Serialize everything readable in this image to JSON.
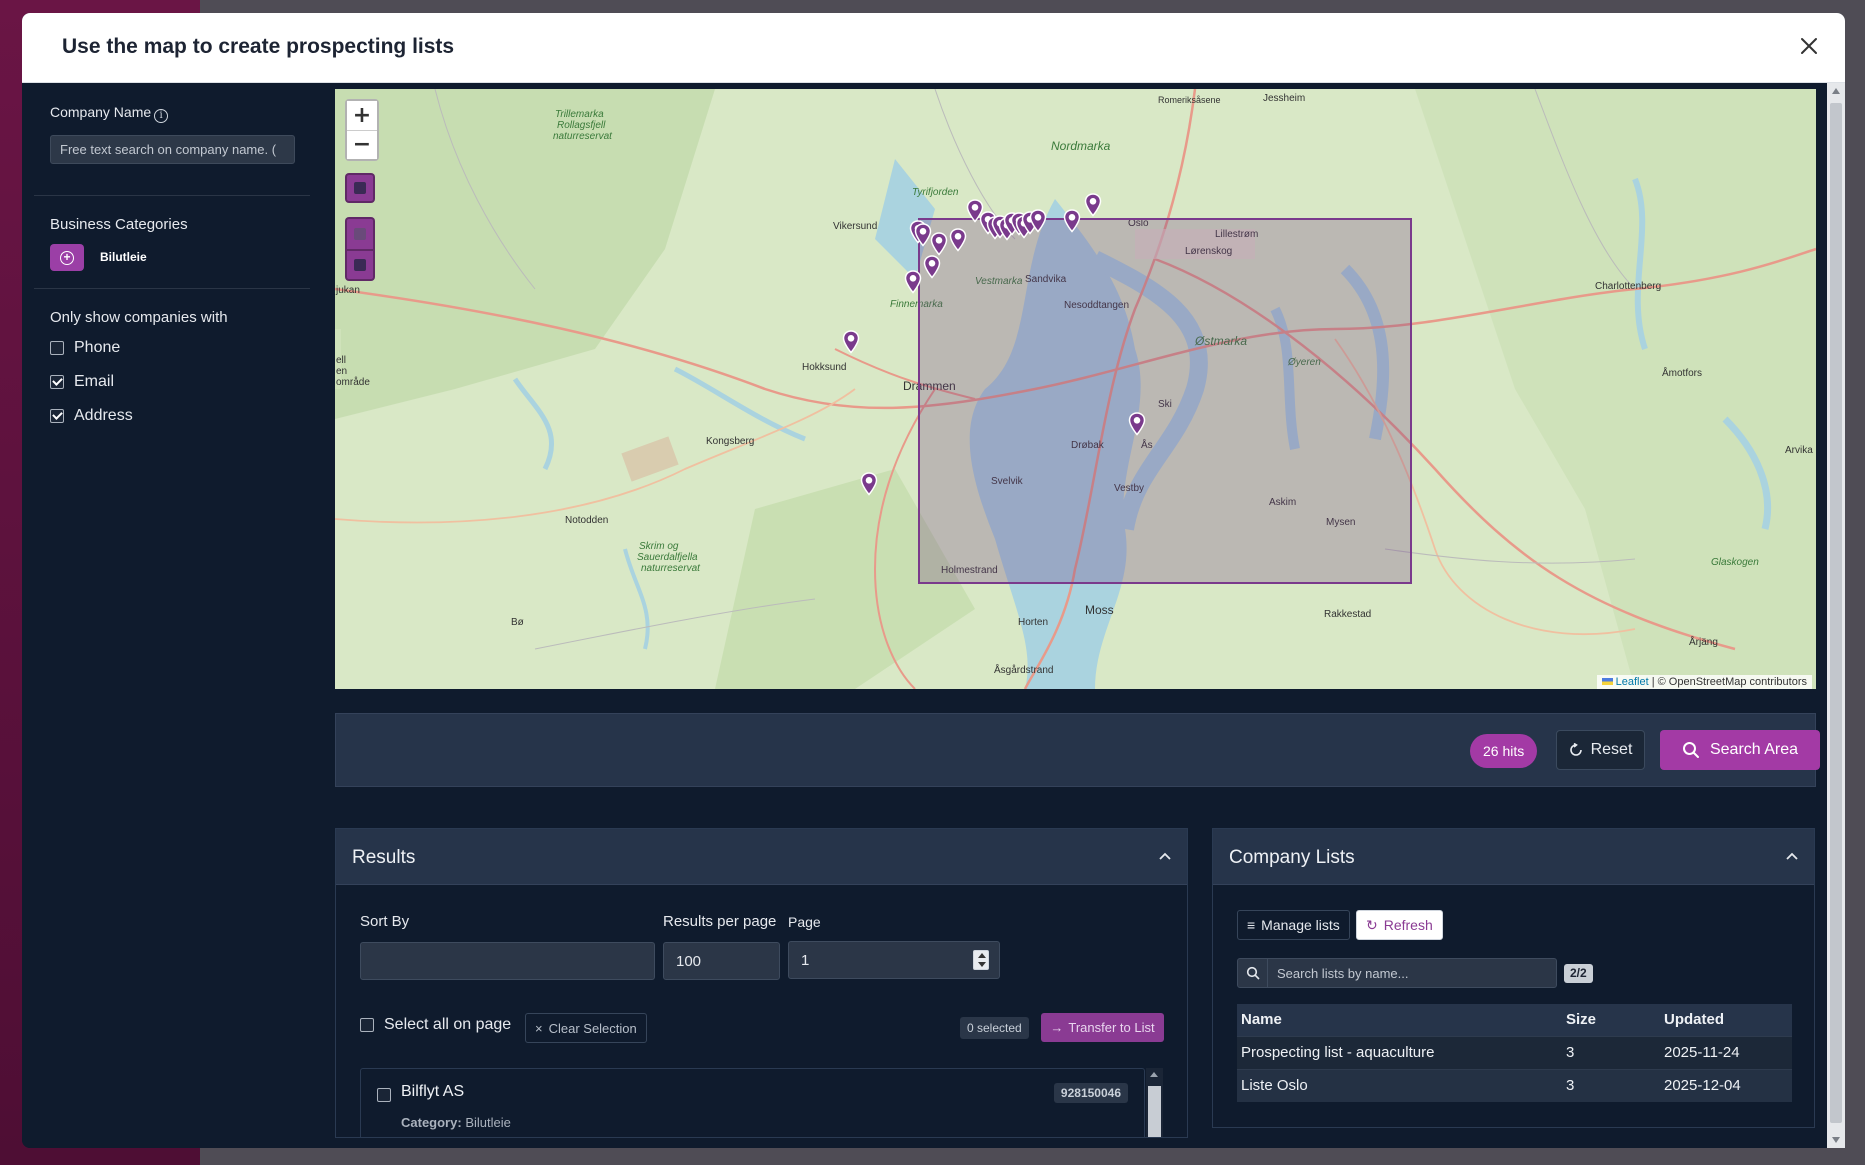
{
  "modal": {
    "title": "Use the map to create prospecting lists"
  },
  "sidebar": {
    "company_name_label": "Company Name",
    "company_name_placeholder": "Free text search on company name. (",
    "business_categories_label": "Business Categories",
    "category_tag": "Bilutleie",
    "only_show_label": "Only show companies with",
    "filters": [
      {
        "label": "Phone",
        "checked": false
      },
      {
        "label": "Email",
        "checked": true
      },
      {
        "label": "Address",
        "checked": true
      }
    ]
  },
  "map": {
    "zoom_in": "+",
    "zoom_out": "−",
    "attribution_leaflet": "Leaflet",
    "attribution_osm": "| © OpenStreetMap contributors",
    "labels": {
      "trillemarka": "Trillemarka",
      "rollagsfjell": "Rollagsfjell",
      "naturreservat1": "naturreservat",
      "nordmarka": "Nordmarka",
      "romeriksasene": "Romeriksåsene",
      "jessheim": "Jessheim",
      "tyrifjorden": "Tyrifjorden",
      "vikersund": "Vikersund",
      "oslo": "Oslo",
      "lillestrom": "Lillestrøm",
      "lorenskog": "Lørenskog",
      "sandvika": "Sandvika",
      "vestmarka": "Vestmarka",
      "finnemarka": "Finnemarka",
      "nesoddtangen": "Nesoddtangen",
      "charlottenberg": "Charlottenberg",
      "jukan": "jukan",
      "hokksund": "Hokksund",
      "drammen": "Drammen",
      "ostmarka": "Østmarka",
      "oyeren": "Øyeren",
      "amotfors": "Åmotfors",
      "kongsberg": "Kongsberg",
      "ski": "Ski",
      "drobak": "Drøbak",
      "as": "Ås",
      "arvika": "Arvika",
      "svelvik": "Svelvik",
      "vestby": "Vestby",
      "askim": "Askim",
      "mysen": "Mysen",
      "notodden": "Notodden",
      "glaskogen": "Glaskogen",
      "skrim": "Skrim og",
      "sauerdalfjella": "Sauerdalfjella",
      "naturreservat2": "naturreservat",
      "holmestrand": "Holmestrand",
      "bo": "Bø",
      "horten": "Horten",
      "moss": "Moss",
      "rakkestad": "Rakkestad",
      "arjang": "Årjäng",
      "asgardstrand": "Åsgårdstrand",
      "omrade": "område",
      "en": "en",
      "ell": "ell"
    }
  },
  "toolbar": {
    "hits": "26 hits",
    "reset": "Reset",
    "search_area": "Search Area"
  },
  "results": {
    "title": "Results",
    "sort_by_label": "Sort By",
    "sort_by_value": "",
    "per_page_label": "Results per page",
    "per_page_value": "100",
    "page_label": "Page",
    "page_value": "1",
    "select_all": "Select all on page",
    "clear_selection": "Clear Selection",
    "selected_count": "0 selected",
    "transfer": "Transfer to List",
    "items": [
      {
        "name": "Bilflyt AS",
        "category_label": "Category:",
        "category": "Bilutleie",
        "org": "928150046"
      }
    ]
  },
  "lists": {
    "title": "Company Lists",
    "manage": "Manage lists",
    "refresh": "Refresh",
    "search_placeholder": "Search lists by name...",
    "count": "2/2",
    "columns": [
      "Name",
      "Size",
      "Updated"
    ],
    "rows": [
      {
        "name": "Prospecting list - aquaculture",
        "size": "3",
        "updated": "2025-11-24"
      },
      {
        "name": "Liste Oslo",
        "size": "3",
        "updated": "2025-12-04"
      }
    ]
  },
  "colors": {
    "accent": "#a33aa5",
    "panel": "#26344a",
    "background": "#0f1b2d"
  }
}
